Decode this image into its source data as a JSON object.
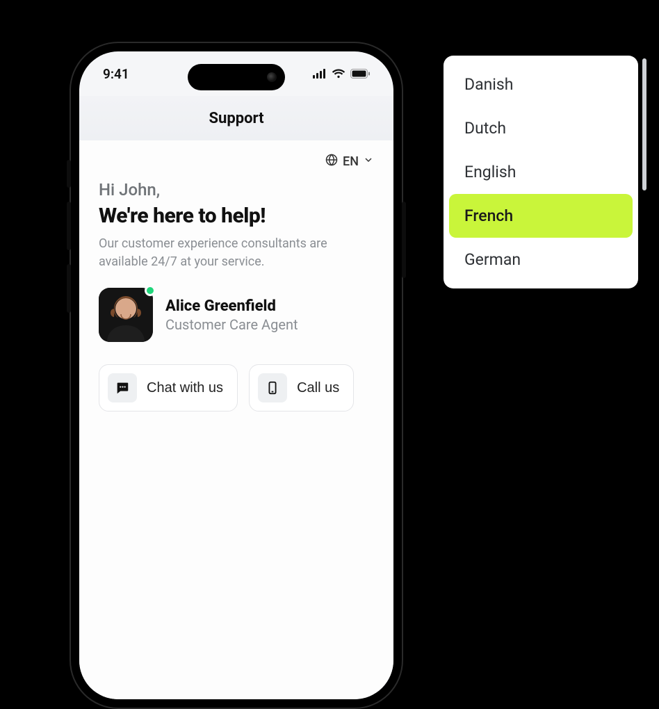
{
  "status": {
    "time": "9:41"
  },
  "header": {
    "title": "Support"
  },
  "language_selector": {
    "current_code": "EN"
  },
  "hero": {
    "greeting": "Hi John,",
    "headline": "We're here to help!",
    "subtext": "Our customer experience consultants are available 24/7 at your service."
  },
  "agent": {
    "name": "Alice Greenfield",
    "role": "Customer Care Agent"
  },
  "actions": {
    "chat_label": "Chat with us",
    "call_label": "Call us"
  },
  "language_menu": {
    "items": [
      {
        "label": "Danish"
      },
      {
        "label": "Dutch"
      },
      {
        "label": "English"
      },
      {
        "label": "French"
      },
      {
        "label": "German"
      }
    ],
    "selected_index": 3
  },
  "colors": {
    "highlight": "#c9f53a",
    "online": "#20d67b"
  }
}
